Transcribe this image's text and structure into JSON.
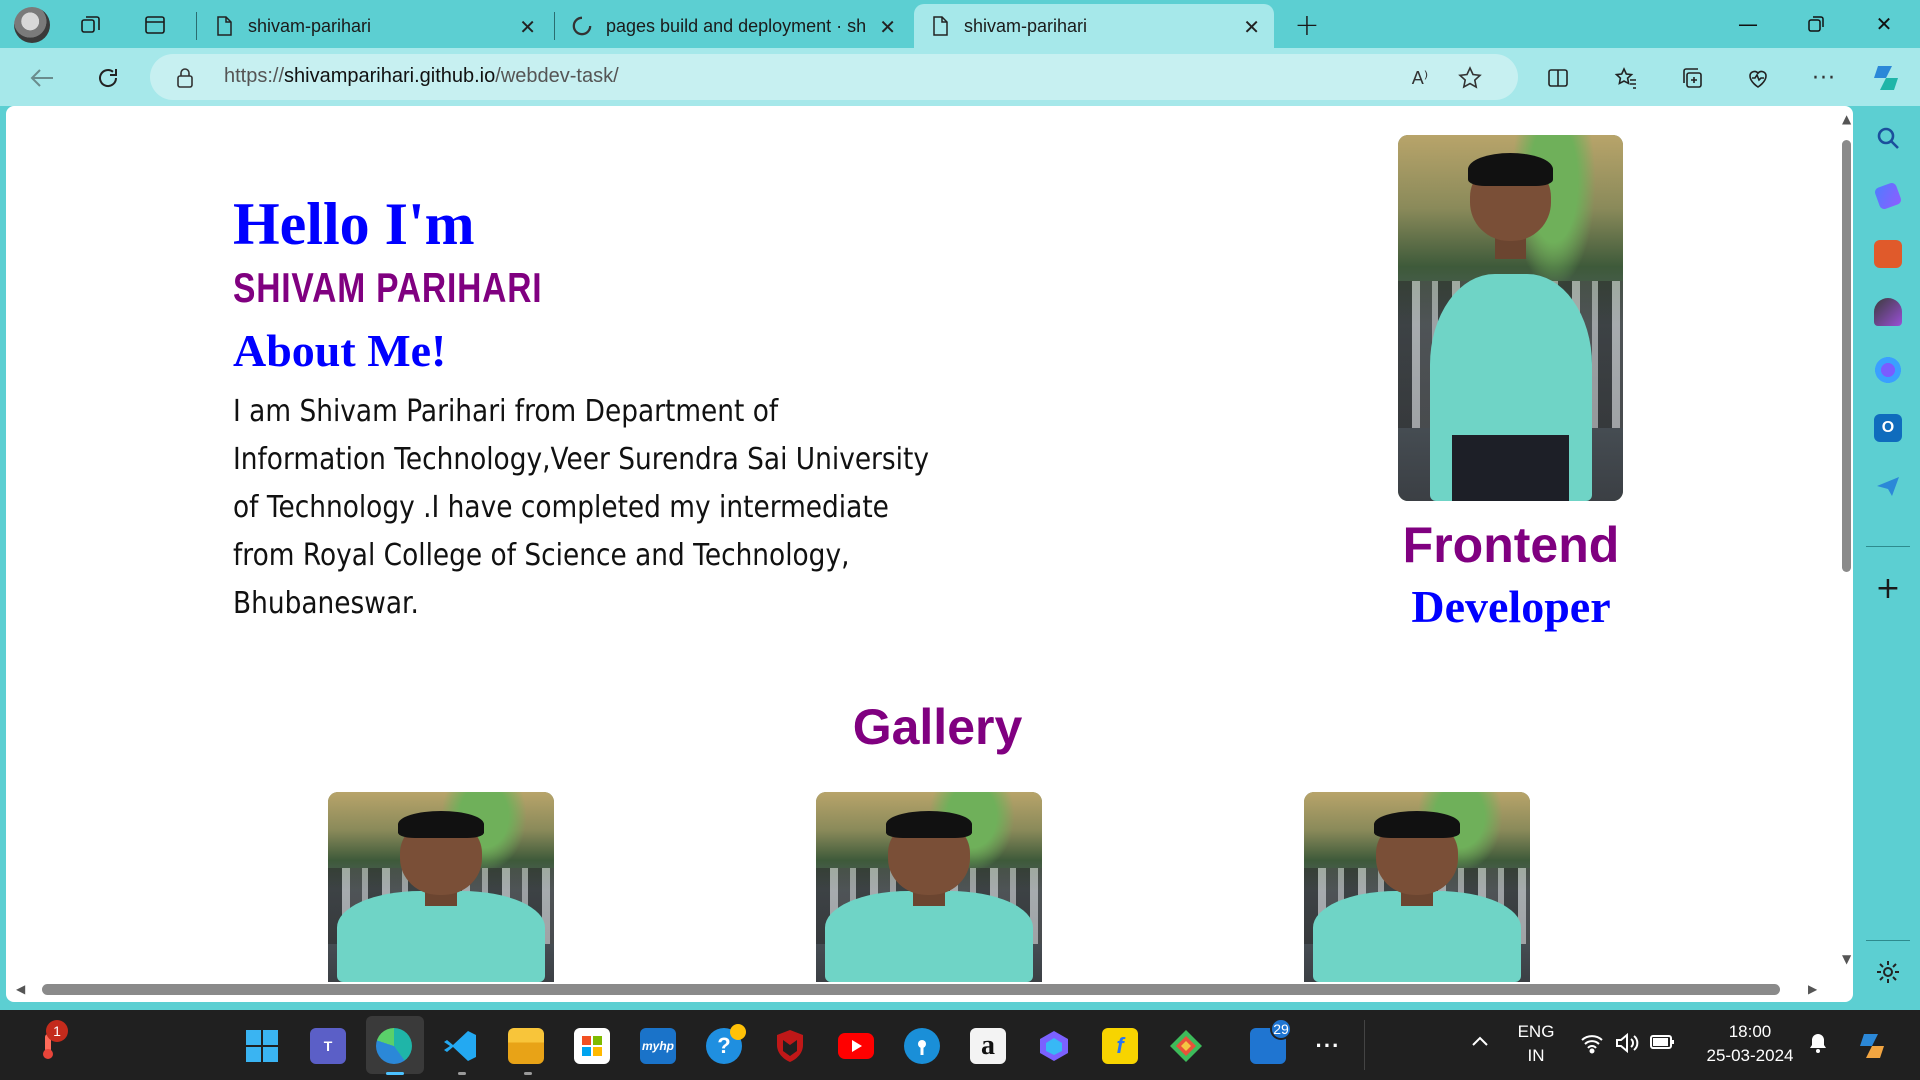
{
  "browser": {
    "tabs": [
      {
        "label": "shivam-parihari",
        "active": false
      },
      {
        "label": "pages build and deployment · sh",
        "active": false
      },
      {
        "label": "shivam-parihari",
        "active": true
      }
    ],
    "address": {
      "protocol": "https://",
      "host": "shivamparihari.github.io",
      "path": "/webdev-task/"
    },
    "read_aloud_glyph": "A⁾"
  },
  "page": {
    "hello": "Hello I'm",
    "name": "SHIVAM PARIHARI",
    "about_heading": "About Me!",
    "bio": "I am Shivam Parihari from Department of Information Technology,Veer Surendra Sai University of Technology .I have completed my intermediate from Royal College of Science and Technology, Bhubaneswar.",
    "role_line1": "Frontend",
    "role_line2": "Developer",
    "gallery_heading": "Gallery"
  },
  "taskbar": {
    "weather_badge": "1",
    "store_badge": "29",
    "lang_line1": "ENG",
    "lang_line2": "IN",
    "time": "18:00",
    "date": "25-03-2024"
  },
  "colors": {
    "accent_teal": "#5ccfd2",
    "address_bg": "#a6e8ea",
    "heading_blue": "#0000ff",
    "heading_purple": "#800080"
  }
}
